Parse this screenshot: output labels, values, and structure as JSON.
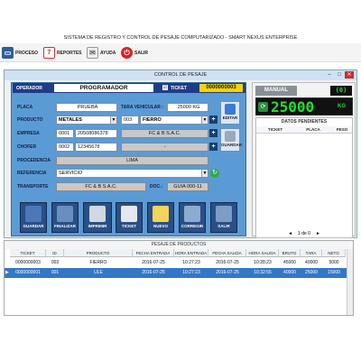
{
  "app": {
    "title": "SISTEMA DE REGISTRO Y CONTROL DE PESAJE COMPUTARIZADO - SMART NEXUS ENTERPRISE"
  },
  "menu": {
    "proceso": "PROCESO",
    "calendar_day": "7",
    "reportes": "REPORTES",
    "ayuda": "AYUDA",
    "salir": "SALIR"
  },
  "dialog": {
    "title": "CONTROL DE PESAJE",
    "min": "–",
    "max": "□",
    "close": "✕"
  },
  "operator": {
    "label": "OPERADOR",
    "value": "PROGRAMADOR",
    "ticket_label": "TICKET",
    "ticket_value": "0000000003",
    "mode": "MANUAL"
  },
  "scale": {
    "reading": "25000",
    "unit": "KG",
    "led": "(0)"
  },
  "form": {
    "placa_label": "PLACA",
    "placa": "PRUEBA",
    "tara_label": "TARA VEHICULAR :",
    "tara": "25000 KG",
    "producto_label": "PRODUCTO",
    "producto": "METALES",
    "producto_code": "003",
    "producto_item": "FIERRO",
    "empresa_label": "EMPRESA",
    "empresa_code": "0001",
    "empresa_ruc": "20508086378",
    "empresa_name": "FC & B S.A.C.",
    "chofer_label": "CHOFER",
    "chofer_code": "0002",
    "chofer_dni": "12345678",
    "chofer_name": "-",
    "procedencia_label": "PROCEDENCIA",
    "procedencia": "LIMA",
    "referencia_label": "REFERENCIA",
    "referencia": "SERVICIO",
    "transporte_label": "TRANSPORTE",
    "transporte": "FC & B S.A.C.",
    "doc_label": "DOC.:",
    "doc": "GUIA 000-11"
  },
  "side_buttons": {
    "editar": "EDITAR",
    "guardar": "GUARDAR"
  },
  "toolbar": {
    "guardar": "GUARDAR",
    "finalizar": "FINALIZAR",
    "imprimir": "IMPRIMIR",
    "ticket": "TICKET",
    "nuevo": "NUEVO",
    "corregir": "CORREGIR",
    "salir": "SALIR"
  },
  "pending": {
    "title": "DATOS PENDIENTES",
    "headers": [
      "TICKET",
      "PLACA",
      "PESO"
    ],
    "pager": "1 de 0",
    "prev": "◄",
    "next": "►"
  },
  "grid": {
    "title": "PESAJE DE PRODUCTOS",
    "headers": [
      "TICKET",
      "ID",
      "PRODUCTO",
      "FECHA ENTRADA",
      "HORA ENTRADA",
      "FECHA SALIDA",
      "HORA SALIDA",
      "BRUTO",
      "TARA",
      "NETO"
    ],
    "rows": [
      [
        "0000000003",
        "003",
        "FIERRO",
        "2016-07-25",
        "10:27:23",
        "2016-07-25",
        "10:28:23",
        "45000",
        "40000",
        "5000"
      ],
      [
        "0000000001",
        "001",
        "ULE",
        "2016-07-25",
        "10:27:23",
        "2016-07-25",
        "10:32:55",
        "40000",
        "25000",
        "15000"
      ]
    ]
  },
  "colors": {
    "panel": "#5b9bd5",
    "navy": "#1f3c88",
    "led_green": "#22dd33",
    "selected_row": "#3378c8"
  }
}
